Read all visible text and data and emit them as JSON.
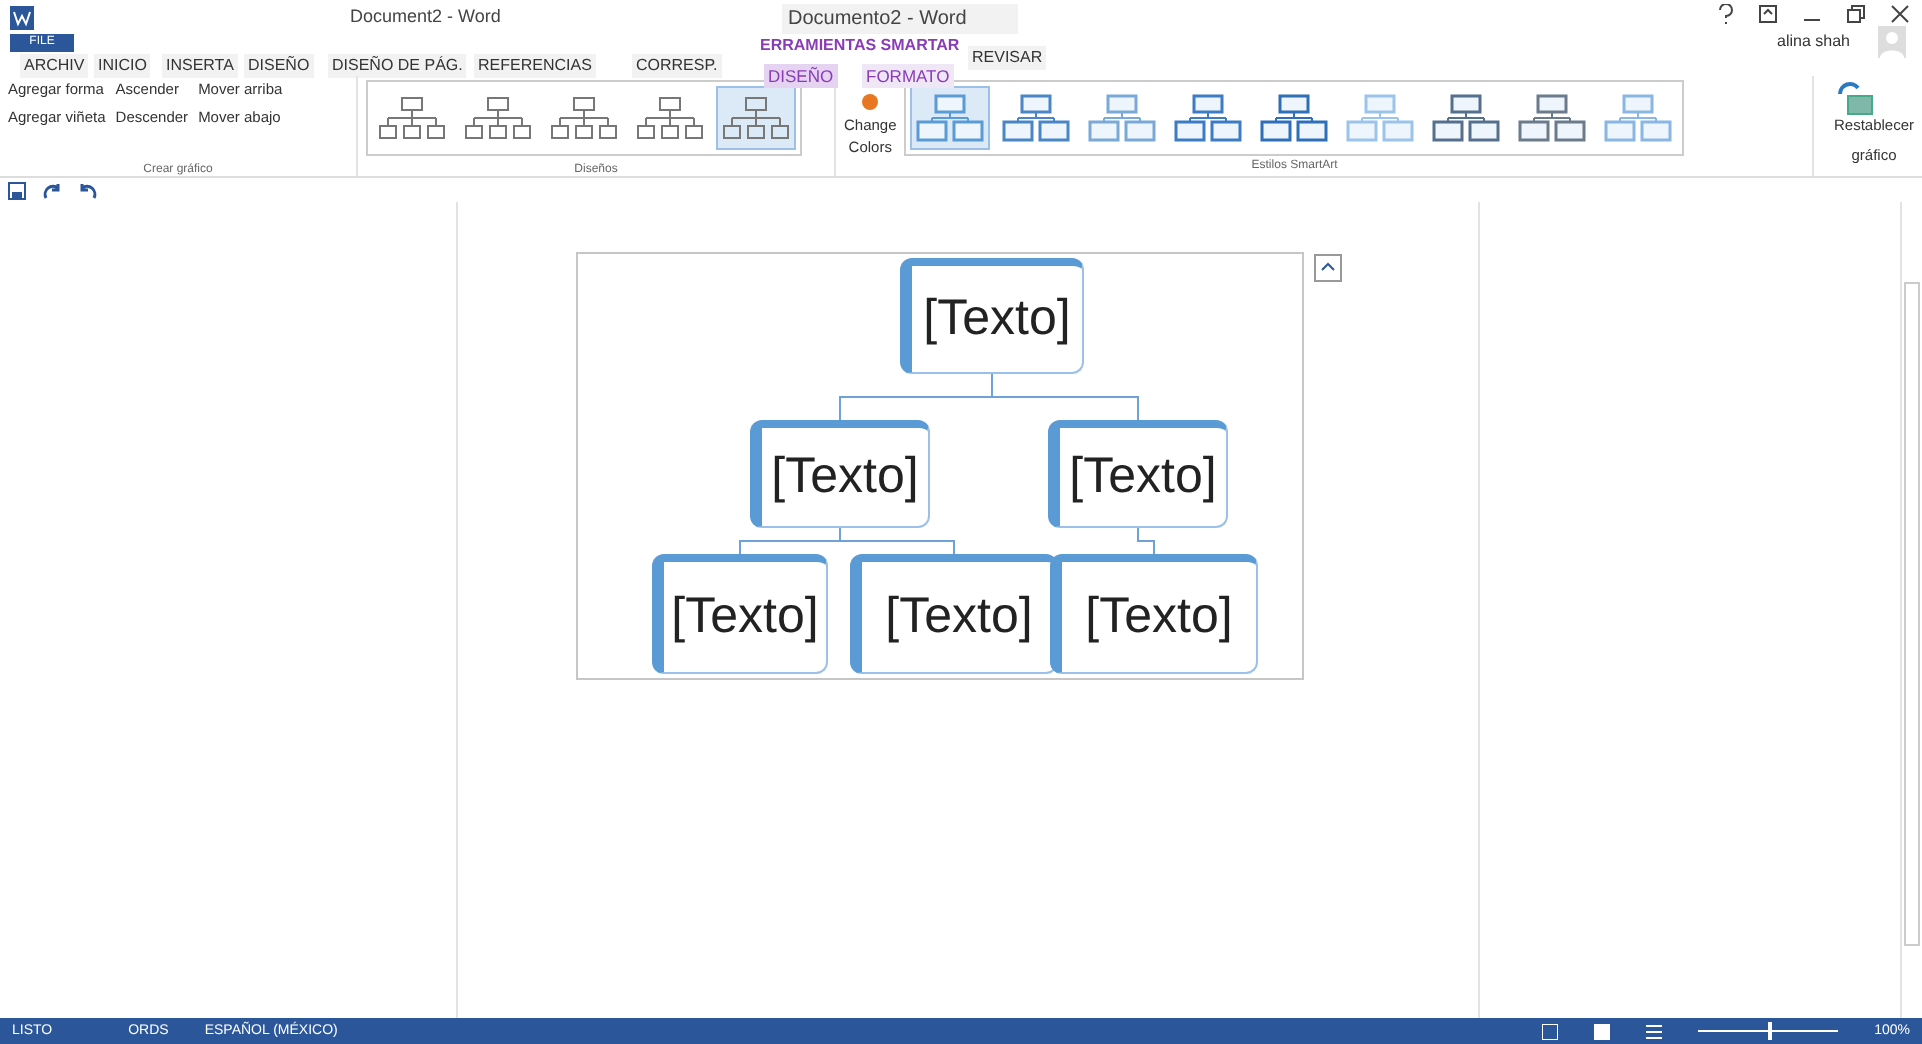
{
  "window": {
    "title": "Document2 - Word",
    "overlay_title": "Documento2 - Word",
    "file_tab": "FILE"
  },
  "tabs": [
    {
      "label": "ARCHIV",
      "selected": false
    },
    {
      "label": "INICIO",
      "selected": false
    },
    {
      "label": "INSERTA",
      "selected": false
    },
    {
      "label": "DISEÑO",
      "selected": false
    },
    {
      "label": "DISEÑO DE PÁG.",
      "selected": false
    },
    {
      "label": "REFERENCIAS",
      "selected": false
    },
    {
      "label": "CORRESP.",
      "selected": false
    }
  ],
  "contextual": {
    "title": "ERRAMIENTAS SMARTAR",
    "tabs": [
      {
        "label": "DISEÑO",
        "selected": true
      },
      {
        "label": "FORMATO",
        "selected": false
      }
    ]
  },
  "review_tab": {
    "label": "REVISAR",
    "selected": false
  },
  "user": "alina shah",
  "create_graphic": {
    "label": "Crear gráfico",
    "buttons": [
      "Agregar forma",
      "Agregar viñeta"
    ],
    "level_buttons": [
      "Ascender",
      "Descender"
    ],
    "move_buttons": [
      "Mover arriba",
      "Mover abajo"
    ]
  },
  "layouts": {
    "label": "Diseños",
    "items": [
      {
        "selected": false
      },
      {
        "selected": false
      },
      {
        "selected": false
      },
      {
        "selected": false
      },
      {
        "selected": true
      }
    ]
  },
  "change_colors": [
    "Change",
    "Colors"
  ],
  "styles": {
    "label": "Estilos SmartArt",
    "items": [
      {
        "selected": true
      },
      {
        "selected": false
      },
      {
        "selected": false
      },
      {
        "selected": false
      },
      {
        "selected": false
      },
      {
        "selected": false
      },
      {
        "selected": false
      },
      {
        "selected": false
      },
      {
        "selected": false
      }
    ]
  },
  "reset": [
    "Restablecer",
    "gráfico"
  ],
  "diagram": {
    "nodes": [
      {
        "text": "[Texto]",
        "children": [
          {
            "text": "[Texto]",
            "children": [
              {
                "text": "[Texto]"
              },
              {
                "text": "[Texto]"
              }
            ]
          },
          {
            "text": "[Texto]",
            "children": [
              {
                "text": "[Texto]"
              }
            ]
          }
        ]
      }
    ]
  },
  "status_bar": {
    "state": "LISTO",
    "words": "ORDS",
    "language": "ESPAÑOL (MÉXICO)",
    "zoom": "100%",
    "level": 0.5
  }
}
